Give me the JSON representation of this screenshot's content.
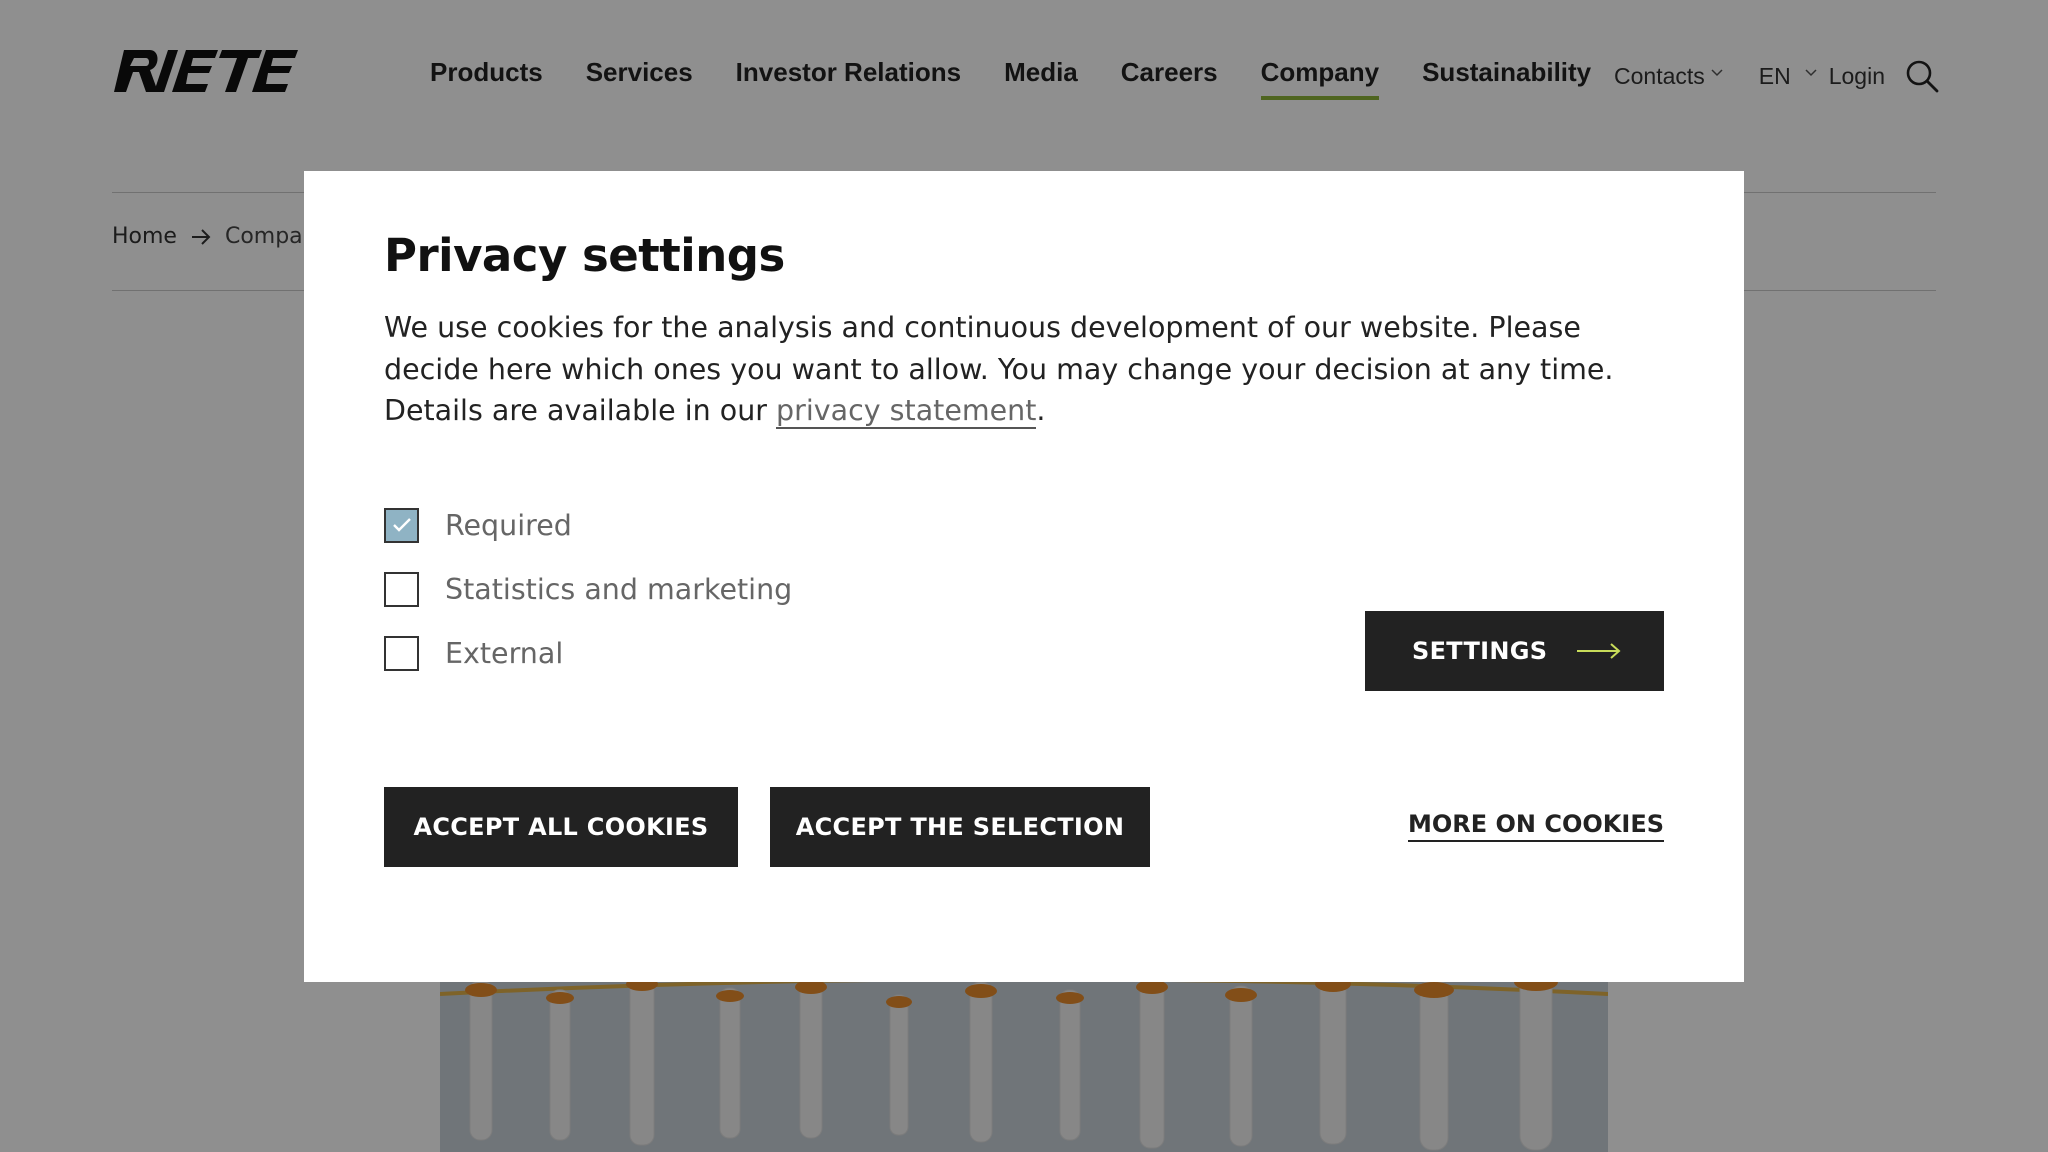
{
  "header": {
    "brand": "RIETER",
    "nav": [
      "Products",
      "Services",
      "Investor Relations",
      "Media",
      "Careers",
      "Company",
      "Sustainability"
    ],
    "active_nav": "Company",
    "utility": {
      "contacts": "Contacts",
      "language": "EN",
      "login": "Login"
    },
    "icons": {
      "contacts_dropdown": "chevron-down-icon",
      "language_dropdown": "chevron-down-icon",
      "search": "search-icon"
    }
  },
  "breadcrumb": {
    "items": [
      "Home",
      "Company"
    ],
    "separator_icon": "arrow-right-icon"
  },
  "privacy_modal": {
    "title": "Privacy settings",
    "text_before_link": "We use cookies for the analysis and continuous development of our website. Please decide here which ones you want to allow. You may change your decision at any time. Details are available in our ",
    "link_text": "privacy statement",
    "text_after_link": ".",
    "options": [
      {
        "label": "Required",
        "checked": true
      },
      {
        "label": "Statistics and marketing",
        "checked": false
      },
      {
        "label": "External",
        "checked": false
      }
    ],
    "settings_button": "SETTINGS",
    "settings_icon": "arrow-right-icon",
    "accept_all_button": "ACCEPT ALL COOKIES",
    "accept_selection_button": "ACCEPT THE SELECTION",
    "more_link": "MORE ON COOKIES"
  },
  "colors": {
    "active_nav_underline": "#8db43a",
    "button_background": "#222222",
    "checkbox_checked": "#8fb3c4",
    "settings_arrow": "#c8dc5a",
    "overlay": "rgba(0,0,0,0.44)"
  }
}
